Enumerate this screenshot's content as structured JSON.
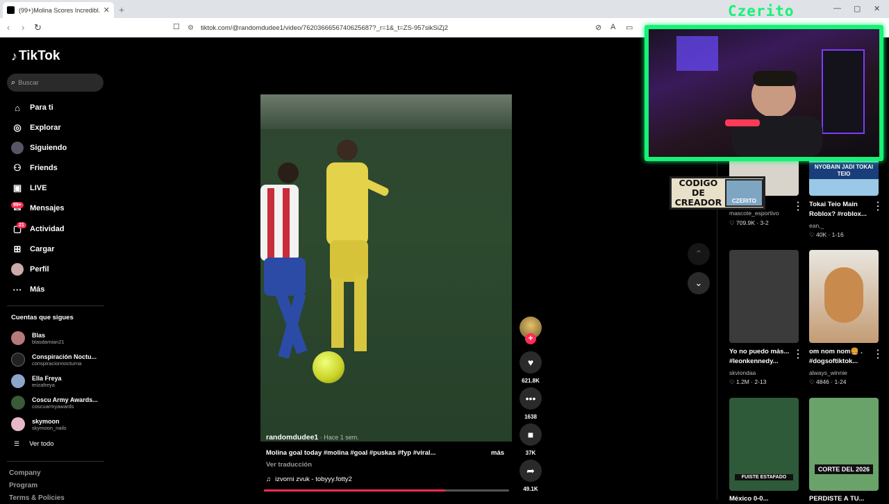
{
  "browser": {
    "tab_title": "(99+)Molina Scores Incredibl...",
    "url": "tiktok.com/@randomdudee1/video/7620366656740625687?_r=1&_t=ZS-957sikSiZj2"
  },
  "brand": "TikTok",
  "search_placeholder": "Buscar",
  "nav": {
    "para_ti": "Para ti",
    "explorar": "Explorar",
    "siguiendo": "Siguiendo",
    "friends": "Friends",
    "live": "LIVE",
    "mensajes": "Mensajes",
    "mensajes_badge": "99+",
    "actividad": "Actividad",
    "actividad_badge": "21",
    "cargar": "Cargar",
    "perfil": "Perfil",
    "mas": "Más"
  },
  "following": {
    "header": "Cuentas que sigues",
    "accounts": [
      {
        "name": "Blas",
        "handle": "blasdamian21",
        "color": "#b57a7a"
      },
      {
        "name": "Conspiración Noctu...",
        "handle": "conspiracionnocturna",
        "color": "#222"
      },
      {
        "name": "Ella Freya",
        "handle": "erizafreya",
        "color": "#8aa7c9"
      },
      {
        "name": "Coscu Army Awards...",
        "handle": "coscuarmyawards",
        "color": "#3a5a3a"
      },
      {
        "name": "skymoon",
        "handle": "skymoon_nails",
        "color": "#e8b7c8"
      }
    ],
    "see_all": "Ver todo"
  },
  "footer": {
    "company": "Company",
    "program": "Program",
    "terms": "Terms & Policies"
  },
  "video": {
    "author": "randomdudee1",
    "time": " · Hace 1 sem.",
    "description": "Molina goal today #molina #goal #puskas #fyp #viral...",
    "more": "más",
    "translate": "Ver traducción",
    "music": "izvorni zvuk - tobyyy.fotty2",
    "progress": 0.74
  },
  "actions": {
    "likes": "621.8K",
    "comments": "1638",
    "saves": "37K",
    "shares": "49.1K"
  },
  "related": [
    {
      "title": "",
      "author": "mascote_esportivo",
      "stats": "709.9K · 3-2",
      "bg": "#d8d4cc"
    },
    {
      "title": "Tokai Teio Main Roblox? #roblox...",
      "author": "ean._",
      "stats": "40K · 1-16",
      "bg": "#9ac8e6"
    },
    {
      "title": "Yo no puedo más... #leonkennedy...",
      "author": "skviondaa",
      "stats": "1.2M · 2-13",
      "bg": "#3b3b3b"
    },
    {
      "title": "om nom nom🍔 . #dogsoftiktok...",
      "author": "always_winnie",
      "stats": "4846 · 1-24",
      "bg": "#c49c74"
    },
    {
      "title": "México 0-0...",
      "author": "",
      "stats": "",
      "bg": "#2e5a3a"
    },
    {
      "title": "PERDISTE A TU...",
      "author": "",
      "stats": "",
      "bg": "#6aa36a"
    }
  ],
  "overlays": {
    "streamer_name": "Czerito",
    "creator_code_label": "CODIGO DE CREADOR",
    "creator_code_tag": "CZERITO",
    "thumb_banner_1": "NYOBAIN JADI TOKAI TEIO",
    "thumb_banner_2": "FUISTE ESTAFADO",
    "thumb_banner_3": "CORTE DEL 2026"
  }
}
